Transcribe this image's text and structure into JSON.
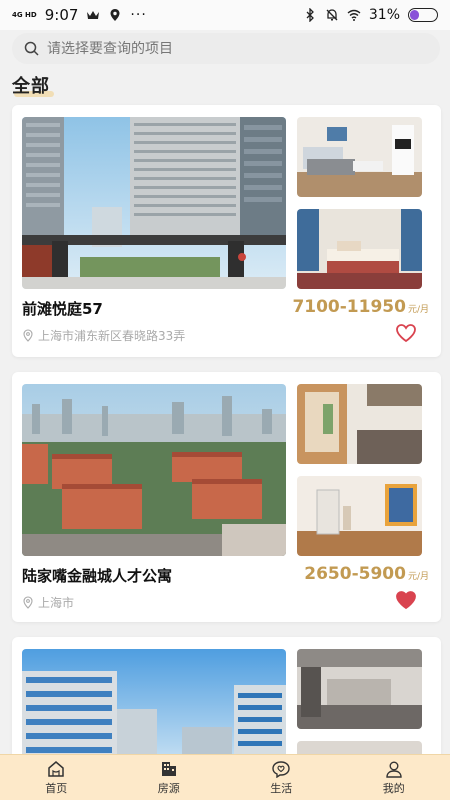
{
  "status_bar": {
    "network": "4G HD",
    "time": "9:07",
    "battery_pct": "31%",
    "battery_level": 0.31,
    "icons": [
      "crown-icon",
      "location-pin-icon",
      "more-icon",
      "bluetooth-icon",
      "mute-bell-icon",
      "wifi-icon",
      "battery-icon"
    ]
  },
  "search": {
    "placeholder": "请选择要查询的项目"
  },
  "section": {
    "title": "全部"
  },
  "listings": [
    {
      "name": "前滩悦庭57",
      "price": "7100-11950",
      "unit": "元/月",
      "address": "上海市浦东新区春晓路33弄",
      "favorited": false
    },
    {
      "name": "陆家嘴金融城人才公寓",
      "price": "2650-5900",
      "unit": "元/月",
      "address": "上海市",
      "favorited": true
    },
    {
      "name": "",
      "price": "",
      "unit": "",
      "address": "",
      "favorited": false
    }
  ],
  "bottom_nav": {
    "items": [
      {
        "label": "首页",
        "icon": "home-icon"
      },
      {
        "label": "房源",
        "icon": "building-icon",
        "active": true
      },
      {
        "label": "生活",
        "icon": "heart-chat-icon"
      },
      {
        "label": "我的",
        "icon": "user-icon"
      }
    ]
  },
  "colors": {
    "accent": "#c29a52",
    "heart": "#d9434f",
    "nav_bg": "#fde9c9"
  }
}
